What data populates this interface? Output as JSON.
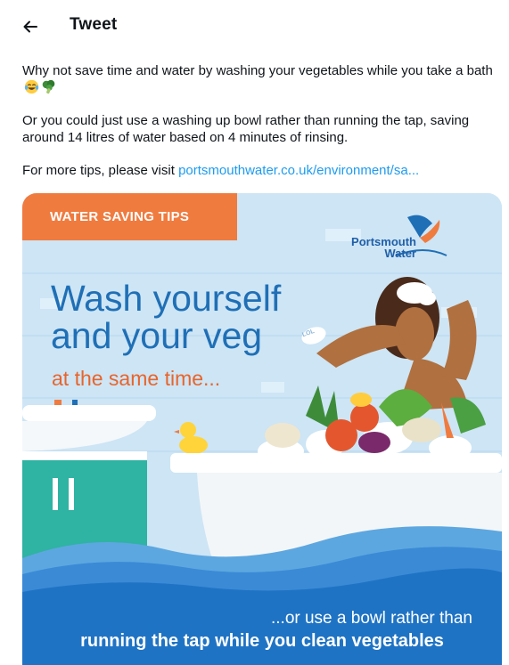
{
  "header": {
    "back_icon": "arrow-left-icon",
    "title": "Tweet"
  },
  "tweet": {
    "paragraph1": "Why not save time and water by washing your vegetables while you take a bath",
    "paragraph1_emojis": [
      "laughing-tears-emoji",
      "broccoli-emoji"
    ],
    "paragraph2": "Or you could just use a washing up bowl rather than running the tap, saving around 14 litres of water based on 4 minutes of rinsing.",
    "paragraph3_prefix": "For more tips, please visit ",
    "link_text": "portsmouthwater.co.uk/environment/sa..."
  },
  "media": {
    "badge": "WATER SAVING TIPS",
    "logo_line1": "Portsmouth",
    "logo_line2": "Water",
    "headline_line1": "Wash yourself",
    "headline_line2": "and your veg",
    "subheadline": "at the same time...",
    "soap_label": "LOL",
    "bottom_line1": "...or use a bowl rather than",
    "bottom_line2": "running the tap while you clean vegetables"
  },
  "colors": {
    "link": "#1d9bf0",
    "badge": "#f07b3f",
    "headline": "#1f6fb6",
    "subheadline": "#e8642b",
    "water": "#1f73c4"
  }
}
